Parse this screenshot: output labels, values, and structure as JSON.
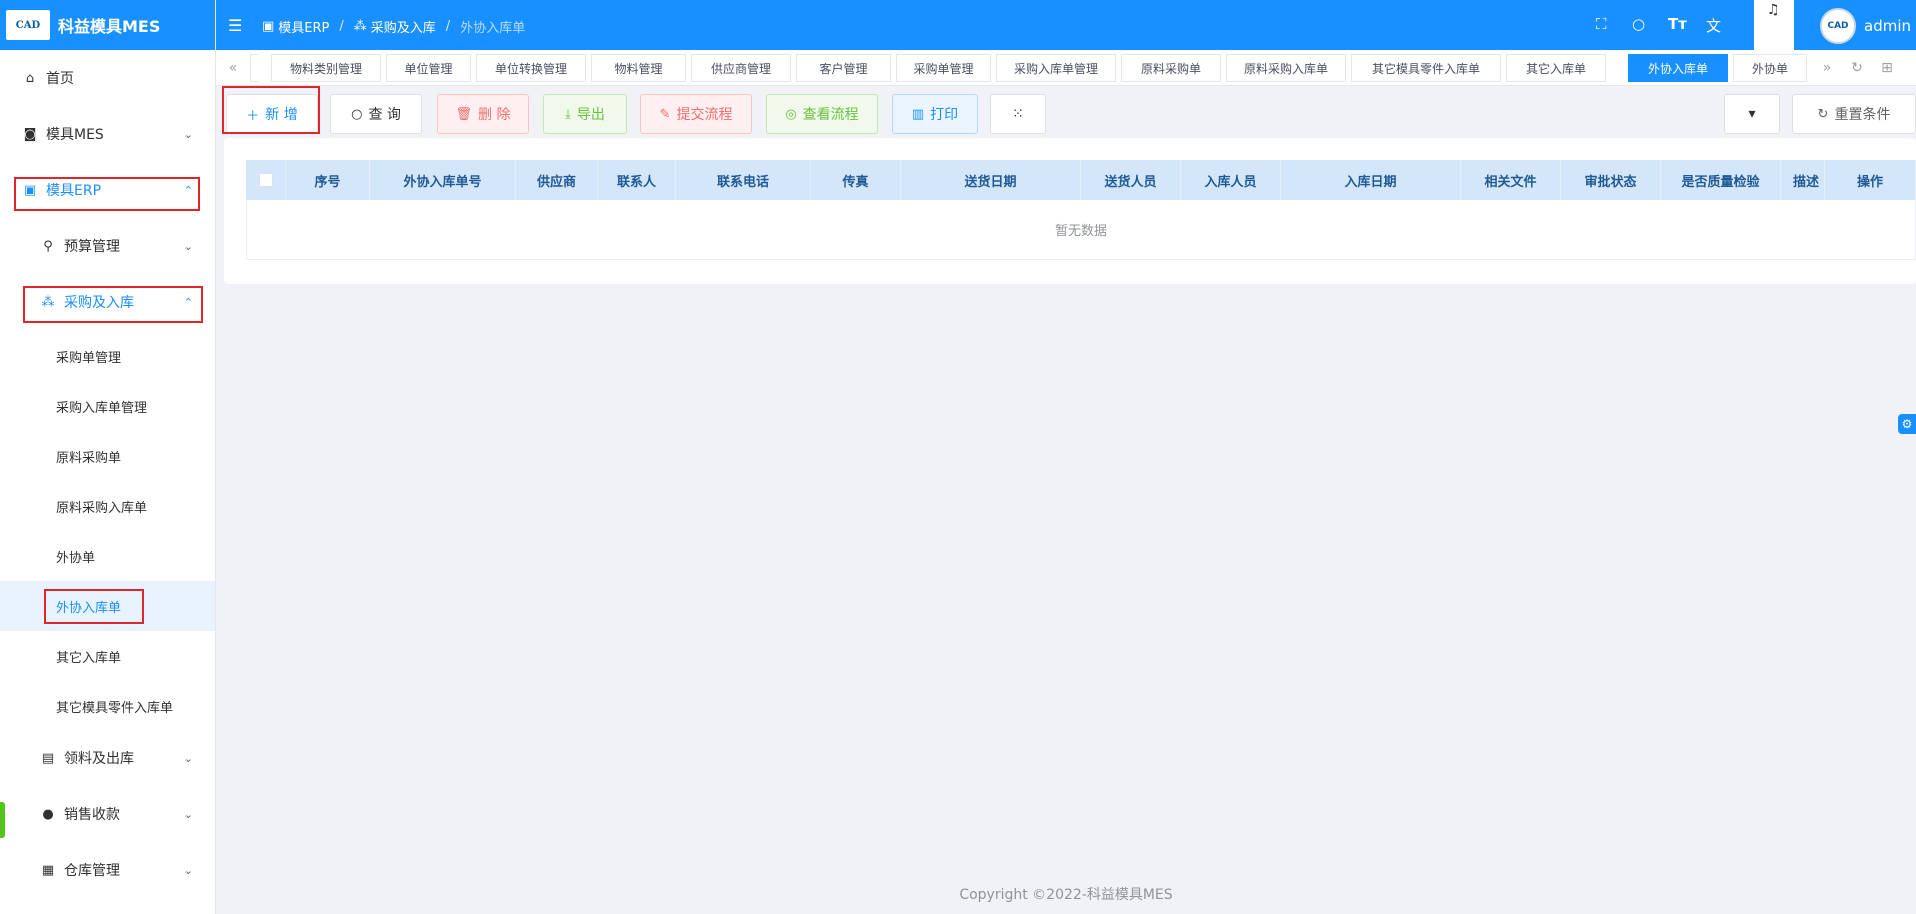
{
  "app": {
    "logo_text": "CAD",
    "title": "科益模具MES"
  },
  "sidebar": {
    "home": "首页",
    "mold_mes": "模具MES",
    "mold_erp": "模具ERP",
    "budget": "预算管理",
    "purchase": "采购及入库",
    "sub_items": [
      "采购单管理",
      "采购入库单管理",
      "原料采购单",
      "原料采购入库单",
      "外协单",
      "外协入库单",
      "其它入库单",
      "其它模具零件入库单"
    ],
    "material_out": "领料及出库",
    "sales": "销售收款",
    "warehouse": "仓库管理"
  },
  "header": {
    "crumbs": [
      "模具ERP",
      "采购及入库",
      "外协入库单"
    ],
    "user": "admin",
    "avatar_text": "CAD"
  },
  "tags": [
    "物料类别管理",
    "单位管理",
    "单位转换管理",
    "物料管理",
    "供应商管理",
    "客户管理",
    "采购单管理",
    "采购入库单管理",
    "原料采购单",
    "原料采购入库单",
    "其它模具零件入库单",
    "其它入库单",
    "外协入库单",
    "外协单"
  ],
  "toolbar": {
    "new": "新 增",
    "query": "查 询",
    "delete": "删 除",
    "export": "导出",
    "submit_flow": "提交流程",
    "view_flow": "查看流程",
    "print": "打印",
    "reset": "重置条件"
  },
  "table": {
    "columns": [
      "序号",
      "外协入库单号",
      "供应商",
      "联系人",
      "联系电话",
      "传真",
      "送货日期",
      "送货人员",
      "入库人员",
      "入库日期",
      "相关文件",
      "审批状态",
      "是否质量检验",
      "描述",
      "操作"
    ],
    "empty": "暂无数据"
  },
  "footer": "Copyright ©2022-科益模具MES"
}
